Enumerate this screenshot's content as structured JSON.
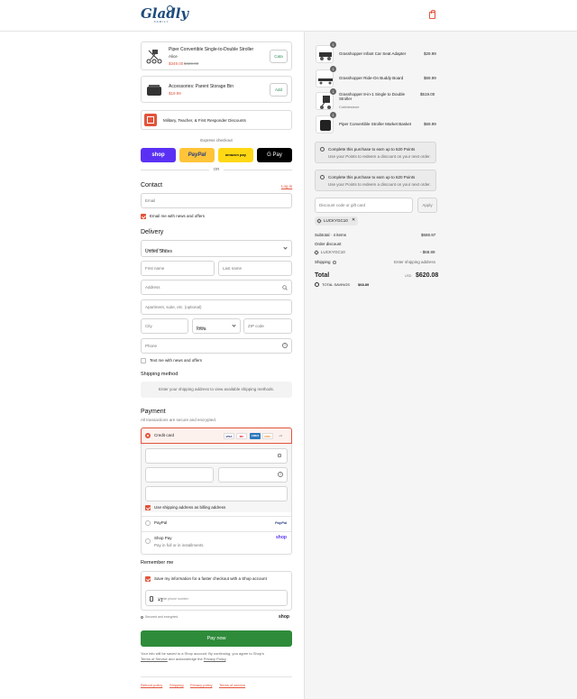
{
  "header": {
    "logo_text": "Gladly",
    "logo_sub": "FAMILY"
  },
  "upsells": [
    {
      "title": "Piper Convertible Single-to-Double Stroller",
      "variant": "Alice",
      "price": "$349.00",
      "compare_price": "$429.00",
      "button": "Cata"
    },
    {
      "title": "Accessories: Parent Storage Bin",
      "price": "$19.99",
      "button": "Add"
    }
  ],
  "discount_card": {
    "label": "Military, Teacher, & First Responder Discounts"
  },
  "express": {
    "label": "Express checkout",
    "buttons": [
      "shop",
      "PayPal",
      "amazon pay",
      "G Pay"
    ],
    "or": "OR"
  },
  "contact": {
    "heading": "Contact",
    "login": "Log in",
    "email_placeholder": "Email",
    "email_news": "Email me with news and offers"
  },
  "delivery": {
    "heading": "Delivery",
    "country_label": "Country/Region",
    "country_value": "United States",
    "first_name": "First name",
    "last_name": "Last name",
    "address": "Address",
    "apartment": "Apartment, suite, etc. (optional)",
    "city": "City",
    "state_label": "State",
    "state_value": "Iowa",
    "zip": "ZIP code",
    "phone": "Phone",
    "text_news": "Text me with news and offers"
  },
  "shipping_method": {
    "heading": "Shipping method",
    "notice": "Enter your shipping address to view available shipping methods."
  },
  "payment": {
    "heading": "Payment",
    "subtitle": "All transactions are secure and encrypted.",
    "credit_card": "Credit card",
    "card_brands": [
      "VISA",
      "MC",
      "AMEX",
      "DISC",
      "+4"
    ],
    "billing_same": "Use shipping address as billing address",
    "paypal": "PayPal",
    "paypal_logo": "PayPal",
    "shop_pay": "Shop Pay",
    "shop_pay_sub": "Pay in full or in installments",
    "shop_logo": "shop"
  },
  "remember": {
    "heading": "Remember me",
    "save_info": "Save my information for a faster checkout with a Shop account",
    "mobile_label": "Mobile phone number",
    "mobile_value": "+1",
    "secured": "Secured and encrypted",
    "shop_logo": "shop"
  },
  "pay_now": "Pay now",
  "legal": {
    "text1": "Your info will be saved to a Shop account. By continuing, you agree to Shop's",
    "terms": "Terms of Service",
    "text2": "and acknowledge the",
    "privacy": "Privacy Policy",
    "dot": "."
  },
  "footer_links": [
    "Refund policy",
    "Shipping",
    "Privacy policy",
    "Terms of service"
  ],
  "order": {
    "items": [
      {
        "qty": "1",
        "name": "Grasshopper Infant Car Seat Adapter",
        "price": "$29.99"
      },
      {
        "qty": "1",
        "name": "Grasshopper Ride-On Buddy Board",
        "price": "$69.99"
      },
      {
        "qty": "1",
        "name": "Grasshopper 8-in-1 Single to Double Stroller",
        "variant": "Cobblestone",
        "price": "$519.00"
      },
      {
        "qty": "1",
        "name": "Piper Convertible Stroller Market Basket",
        "price": "$69.99"
      }
    ],
    "points": [
      {
        "title": "Complete this purchase to earn up to 620 Points",
        "sub": "Use your Points to redeem a discount on your next order."
      },
      {
        "title": "Complete this purchase to earn up to 620 Points",
        "sub": "Use your Points to redeem a discount on your next order."
      }
    ],
    "discount_placeholder": "Discount code or gift card",
    "apply": "Apply",
    "code_chip": "LUCKYGC10",
    "subtotal_label": "Subtotal · 4 items",
    "subtotal_value": "$688.97",
    "order_discount_label": "Order discount",
    "order_discount_code": "LUCKYGC10",
    "order_discount_value": "- $68.89",
    "shipping_label": "Shipping",
    "shipping_value": "Enter shipping address",
    "total_label": "Total",
    "currency": "USD",
    "total_value": "$620.08",
    "savings_label": "TOTAL SAVINGS",
    "savings_value": "$68.89"
  },
  "colors": {
    "accent": "#e2543b",
    "pay_now": "#2e8b3a",
    "shop_purple": "#5a31f4",
    "paypal_yellow": "#ffc439"
  }
}
